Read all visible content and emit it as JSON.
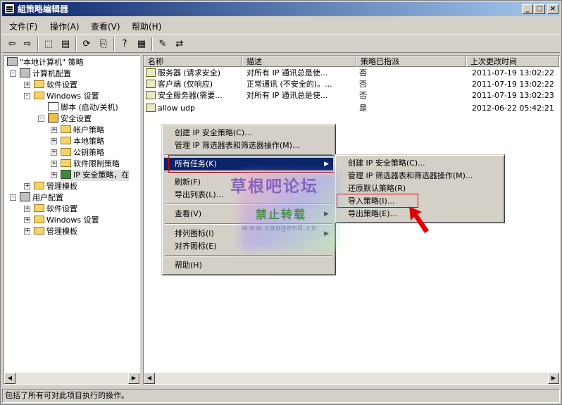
{
  "window": {
    "title": "組策略编辑器",
    "controls": {
      "minimize": "_",
      "maximize": "□",
      "close": "×"
    }
  },
  "menubar": [
    {
      "label": "文件(F)"
    },
    {
      "label": "操作(A)"
    },
    {
      "label": "查看(V)"
    },
    {
      "label": "帮助(H)"
    }
  ],
  "toolbar": [
    {
      "name": "back",
      "glyph": "⇦"
    },
    {
      "name": "forward",
      "glyph": "⇨"
    },
    {
      "name": "up-folder",
      "glyph": "⬚"
    },
    {
      "name": "show-tree",
      "glyph": "▤"
    },
    {
      "name": "refresh",
      "glyph": "⟳"
    },
    {
      "name": "export-list",
      "glyph": "⎘"
    },
    {
      "name": "help",
      "glyph": "?"
    },
    {
      "name": "view",
      "glyph": "▦"
    },
    {
      "name": "policy",
      "glyph": "✎"
    },
    {
      "name": "assign",
      "glyph": "⇄"
    }
  ],
  "tree": [
    {
      "label": "\"本地计算机\" 策略",
      "level": 0,
      "expander": "",
      "icon": "policy"
    },
    {
      "label": "计算机配置",
      "level": 1,
      "expander": "-",
      "icon": "computer"
    },
    {
      "label": "软件设置",
      "level": 2,
      "expander": "+",
      "icon": "folder"
    },
    {
      "label": "Windows 设置",
      "level": 2,
      "expander": "-",
      "icon": "folder"
    },
    {
      "label": "脚本 (启动/关机)",
      "level": 3,
      "expander": "",
      "icon": "script"
    },
    {
      "label": "安全设置",
      "level": 3,
      "expander": "-",
      "icon": "security"
    },
    {
      "label": "帐户策略",
      "level": 4,
      "expander": "+",
      "icon": "folder"
    },
    {
      "label": "本地策略",
      "level": 4,
      "expander": "+",
      "icon": "folder"
    },
    {
      "label": "公钥策略",
      "level": 4,
      "expander": "+",
      "icon": "folder"
    },
    {
      "label": "软件限制策略",
      "level": 4,
      "expander": "+",
      "icon": "folder"
    },
    {
      "label": "IP 安全策略，在",
      "level": 4,
      "expander": "+",
      "icon": "ipsec"
    },
    {
      "label": "管理模板",
      "level": 2,
      "expander": "+",
      "icon": "folder"
    },
    {
      "label": "用户配置",
      "level": 1,
      "expander": "-",
      "icon": "user"
    },
    {
      "label": "软件设置",
      "level": 2,
      "expander": "+",
      "icon": "folder"
    },
    {
      "label": "Windows 设置",
      "level": 2,
      "expander": "+",
      "icon": "folder"
    },
    {
      "label": "管理模板",
      "level": 2,
      "expander": "+",
      "icon": "folder"
    }
  ],
  "list": {
    "columns": [
      "名称",
      "描述",
      "策略已指派",
      "上次更改时间"
    ],
    "rows": [
      {
        "name": "服务器 (请求安全)",
        "desc": "对所有 IP 通讯总是使...",
        "assigned": "否",
        "modified": "2011-07-19 13:02:22"
      },
      {
        "name": "客户端 (仅响应)",
        "desc": "正常通讯 (不安全的)。...",
        "assigned": "否",
        "modified": "2011-07-19 13:02:22"
      },
      {
        "name": "安全服务器(需要...",
        "desc": "对所有 IP 通讯总是使...",
        "assigned": "否",
        "modified": "2011-07-19 13:02:23"
      },
      {
        "name": "allow udp",
        "desc": "",
        "assigned": "是",
        "modified": "2012-06-22 05:42:21"
      }
    ]
  },
  "context_menu": {
    "items": [
      {
        "label": "创建 IP 安全策略(C)...",
        "type": "item"
      },
      {
        "label": "管理 IP 筛选器表和筛选器操作(M)...",
        "type": "item"
      },
      {
        "type": "sep"
      },
      {
        "label": "所有任务(K)",
        "type": "submenu",
        "selected": true
      },
      {
        "type": "sep"
      },
      {
        "label": "刷新(F)",
        "type": "item"
      },
      {
        "label": "导出列表(L)...",
        "type": "item"
      },
      {
        "type": "sep"
      },
      {
        "label": "查看(V)",
        "type": "submenu"
      },
      {
        "type": "sep"
      },
      {
        "label": "排列图标(I)",
        "type": "submenu"
      },
      {
        "label": "对齐图标(E)",
        "type": "item"
      },
      {
        "type": "sep"
      },
      {
        "label": "帮助(H)",
        "type": "item"
      }
    ]
  },
  "submenu": {
    "items": [
      {
        "label": "创建 IP 安全策略(C)..."
      },
      {
        "label": "管理 IP 筛选器表和筛选器操作(M)..."
      },
      {
        "label": "还原默认策略(R)"
      },
      {
        "label": "导入策略(I)...",
        "highlighted": true
      },
      {
        "label": "导出策略(E)..."
      }
    ]
  },
  "watermark": {
    "line1": "草根吧论坛",
    "line2": "禁止转载",
    "line3": "www.caogen8.co"
  },
  "statusbar": {
    "text": "包括了所有可对此项目执行的操作。"
  },
  "colors": {
    "title_start": "#0a246a",
    "title_end": "#a6caf0",
    "selection": "#0a246a",
    "highlight_box": "#e00000",
    "pointer_arrow": "#e00000"
  }
}
